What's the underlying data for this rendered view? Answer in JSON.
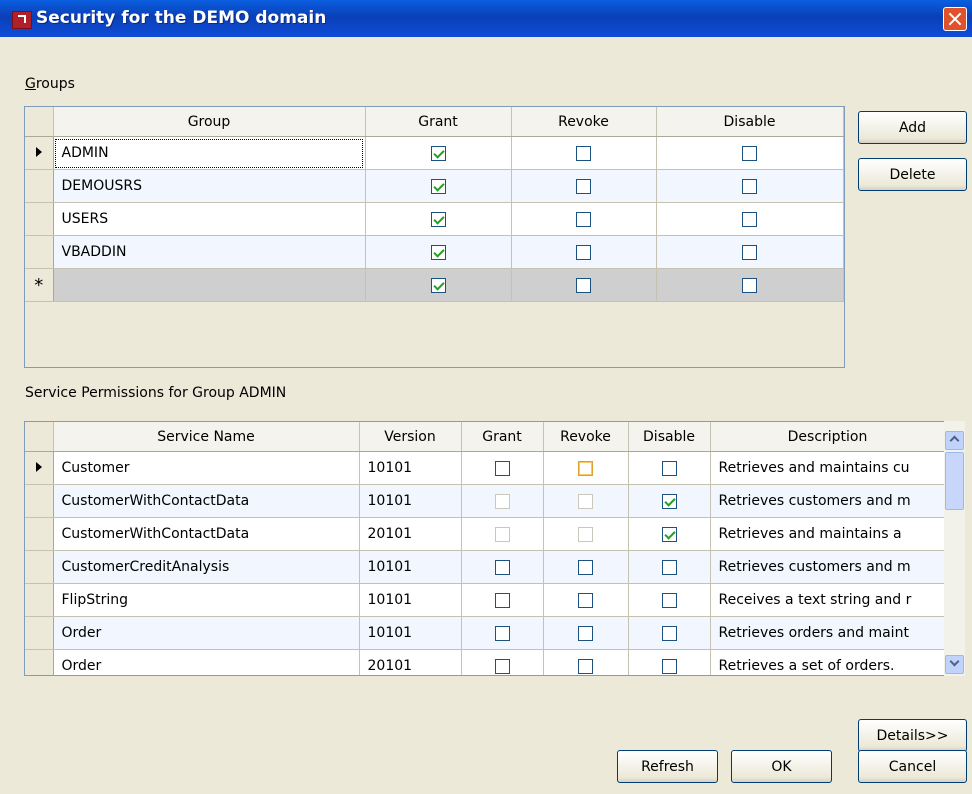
{
  "window": {
    "title": "Security for the DEMO domain"
  },
  "groups": {
    "label": "Groups",
    "columns": [
      "Group",
      "Grant",
      "Revoke",
      "Disable"
    ],
    "rows": [
      {
        "name": "ADMIN",
        "grant": true,
        "revoke": false,
        "disable": false
      },
      {
        "name": "DEMOUSRS",
        "grant": true,
        "revoke": false,
        "disable": false
      },
      {
        "name": "USERS",
        "grant": true,
        "revoke": false,
        "disable": false
      },
      {
        "name": "VBADDIN",
        "grant": true,
        "revoke": false,
        "disable": false
      }
    ],
    "new_row_marker": "*",
    "new_row": {
      "grant": true,
      "revoke": false,
      "disable": false
    },
    "add_label": "Add",
    "delete_label": "Delete"
  },
  "services": {
    "label": "Service Permissions for Group ADMIN",
    "columns": [
      "Service Name",
      "Version",
      "Grant",
      "Revoke",
      "Disable",
      "Description"
    ],
    "rows": [
      {
        "name": "Customer",
        "version": "10101",
        "grant": false,
        "revoke": false,
        "disable": false,
        "description": "Retrieves and maintains cu"
      },
      {
        "name": "CustomerWithContactData",
        "version": "10101",
        "grant": false,
        "revoke": false,
        "disable": true,
        "description": "Retrieves customers and m"
      },
      {
        "name": "CustomerWithContactData",
        "version": "20101",
        "grant": false,
        "revoke": false,
        "disable": true,
        "description": "Retrieves and maintains a"
      },
      {
        "name": "CustomerCreditAnalysis",
        "version": "10101",
        "grant": false,
        "revoke": false,
        "disable": false,
        "description": "Retrieves customers and m"
      },
      {
        "name": "FlipString",
        "version": "10101",
        "grant": false,
        "revoke": false,
        "disable": false,
        "description": "Receives a text string and r"
      },
      {
        "name": "Order",
        "version": "10101",
        "grant": false,
        "revoke": false,
        "disable": false,
        "description": "Retrieves orders and maint"
      },
      {
        "name": "Order",
        "version": "20101",
        "grant": false,
        "revoke": false,
        "disable": false,
        "description": "Retrieves a set of orders."
      }
    ]
  },
  "buttons": {
    "details": "Details>>",
    "refresh": "Refresh",
    "ok": "OK",
    "cancel": "Cancel"
  },
  "colors": {
    "titlebar": "#0a4fd0",
    "dialog_bg": "#ece9d8",
    "check_mark": "#21a121",
    "close_button": "#e0522b"
  }
}
